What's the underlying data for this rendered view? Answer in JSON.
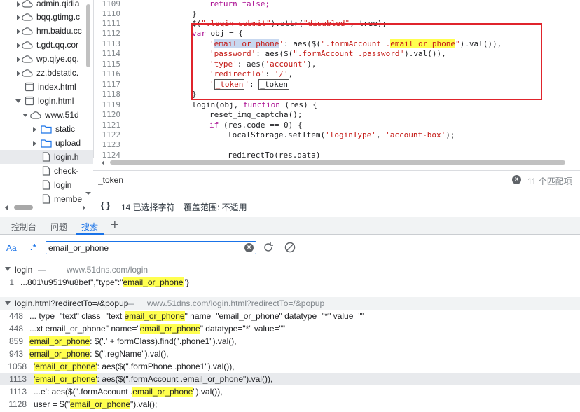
{
  "file_tree": {
    "items": [
      {
        "label": "admin.qidia",
        "type": "cloud",
        "indent": 1
      },
      {
        "label": "bqq.gtimg.c",
        "type": "cloud",
        "indent": 1
      },
      {
        "label": "hm.baidu.cc",
        "type": "cloud",
        "indent": 1
      },
      {
        "label": "t.gdt.qq.cor",
        "type": "cloud",
        "indent": 1
      },
      {
        "label": "wp.qiye.qq.",
        "type": "cloud",
        "indent": 1
      },
      {
        "label": "zz.bdstatic.",
        "type": "cloud",
        "indent": 1
      },
      {
        "label": "index.html",
        "type": "page",
        "indent": 1
      },
      {
        "label": "login.html",
        "type": "page",
        "indent": 1
      },
      {
        "label": "www.51d",
        "type": "cloud",
        "indent": 2
      },
      {
        "label": "static",
        "type": "folder",
        "indent": 3
      },
      {
        "label": "upload",
        "type": "folder",
        "indent": 3
      },
      {
        "label": "login.h",
        "type": "file",
        "indent": 4
      },
      {
        "label": "check-",
        "type": "file",
        "indent": 4
      },
      {
        "label": "login",
        "type": "file",
        "indent": 4
      },
      {
        "label": "membe",
        "type": "file",
        "indent": 4
      }
    ]
  },
  "editor": {
    "line_numbers": [
      "1109",
      "1110",
      "1111",
      "1112",
      "1113",
      "1114",
      "1115",
      "1116",
      "1117",
      "1118",
      "1119",
      "1120",
      "1121",
      "1122",
      "1123",
      "1124"
    ]
  },
  "code": {
    "l1109": "return false;",
    "l1110": "}",
    "l1111a": "$(",
    "l1111b": "\".login-submit\"",
    "l1111c": ").attr(",
    "l1111d": "\"disabled\"",
    "l1111e": ", true);",
    "l1112a": "var",
    "l1112b": " obj = {",
    "l1113a": "'",
    "l1113b": "email_or_phone",
    "l1113c": "'",
    "l1113d": ": aes($(",
    "l1113e": "\".formAccount .",
    "l1113f": "email_or_phone",
    "l1113g": "\"",
    "l1113h": ").val()),",
    "l1114a": "'password'",
    "l1114b": ": aes($(",
    "l1114c": "\".formAccount .password\"",
    "l1114d": ").val()),",
    "l1115a": "'type'",
    "l1115b": ": aes(",
    "l1115c": "'account'",
    "l1115d": "),",
    "l1116a": "'redirectTo'",
    "l1116b": ": ",
    "l1116c": "'/'",
    "l1116d": ",",
    "l1117a": "'",
    "l1117b": "_token",
    "l1117c": "'",
    "l1117d": ": ",
    "l1117e": "_token",
    "l1118": "}",
    "l1119a": "login(obj, ",
    "l1119b": "function",
    "l1119c": " (res) {",
    "l1120": "reset_img_captcha();",
    "l1121a": "if",
    "l1121b": " (res.code == 0) {",
    "l1122a": "localStorage.setItem(",
    "l1122b": "'loginType'",
    "l1122c": ", ",
    "l1122d": "'account-box'",
    "l1122e": ");",
    "l1124": "redirectTo(res.data)"
  },
  "find_bar": {
    "query": "_token",
    "count": "11 个匹配项"
  },
  "status_bar": {
    "braces": "{ }",
    "selected": "14 已选择字符",
    "coverage": "覆盖范围: 不适用"
  },
  "drawer_tabs": {
    "console": "控制台",
    "issues": "问题",
    "search": "搜索",
    "add": "+"
  },
  "search_toolbar": {
    "case_label": "Aa",
    "regex_label": ".*",
    "query": "email_or_phone"
  },
  "results": {
    "group1_file": "login",
    "group1_sep": " — ",
    "group1_url": "www.51dns.com/login",
    "g1r1_line": "1",
    "g1r1_pre": "...801\\u9519\\u8bef\",\"type\":\"",
    "g1r1_match": "email_or_phone",
    "g1r1_post": "\"}",
    "group2_file": "login.html?redirectTo=/&popup",
    "group2_sep": " — ",
    "group2_url": "www.51dns.com/login.html?redirectTo=/&popup",
    "r1_line": "448",
    "r1_pre": "... type=\"text\" class=\"text ",
    "r1_match": "email_or_phone",
    "r1_post": "\" name=\"email_or_phone\" datatype=\"*\" value=\"\"",
    "r2_line": "448",
    "r2_pre": "...xt email_or_phone\" name=\"",
    "r2_match": "email_or_phone",
    "r2_post": "\" datatype=\"*\" value=\"\"",
    "r3_line": "859",
    "r3_pre": "",
    "r3_match": "email_or_phone",
    "r3_post": ": $('.' + formClass).find(\".phone1\").val(),",
    "r4_line": "943",
    "r4_pre": "",
    "r4_match": "email_or_phone",
    "r4_post": ": $(\".regName\").val(),",
    "r5_line": "1058",
    "r5_pre": "",
    "r5_match": "'email_or_phone'",
    "r5_post": ": aes($(\".formPhone .phone1\").val()),",
    "r6_line": "1113",
    "r6_pre": "",
    "r6_match": "'email_or_phone'",
    "r6_post": ": aes($(\".formAccount .email_or_phone\").val()),",
    "r7_line": "1113",
    "r7_pre": "...e': aes($(\".formAccount .",
    "r7_match": "email_or_phone",
    "r7_post": "\").val()),",
    "r8_line": "1128",
    "r8_pre": "user = $(\"",
    "r8_match": "email_or_phone",
    "r8_post": "\").val();"
  },
  "colors": {
    "accent": "#1a73e8",
    "highlight_box": "#e0242c",
    "match_bg": "#ffff4f"
  }
}
